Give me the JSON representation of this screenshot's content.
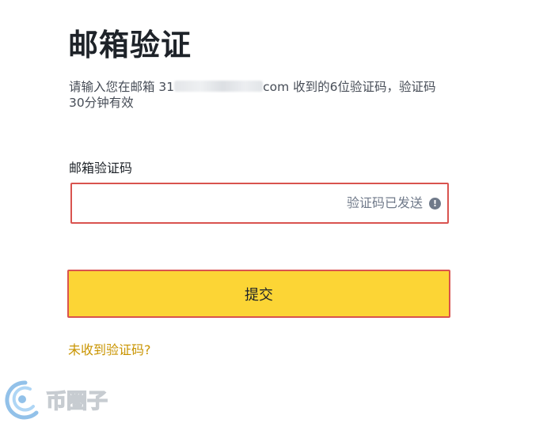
{
  "page": {
    "title": "邮箱验证",
    "description_prefix": "请输入您在邮箱 31",
    "description_suffix": "com 收到的6位验证码，验证码30分钟有效"
  },
  "form": {
    "code_label": "邮箱验证码",
    "code_value": "",
    "code_sent_text": "验证码已发送",
    "info_icon_glyph": "!",
    "submit_label": "提交",
    "resend_link": "未收到验证码?"
  },
  "watermark": {
    "text": "币圈子"
  },
  "colors": {
    "accent_yellow": "#fcd535",
    "error_border": "#d9534f",
    "link": "#c99400"
  }
}
